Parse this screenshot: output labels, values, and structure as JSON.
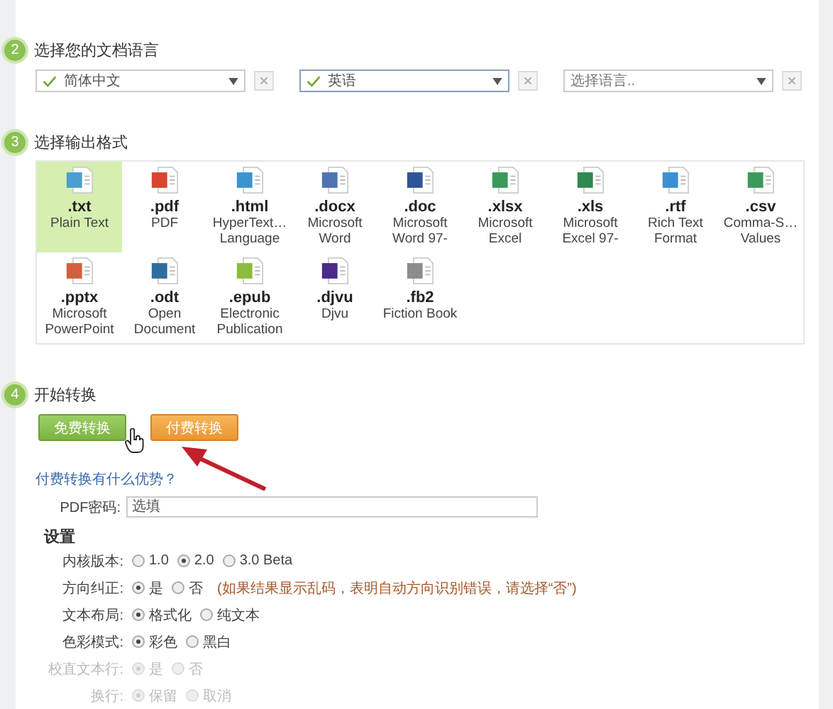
{
  "steps": [
    {
      "number": "2",
      "title": "选择您的文档语言"
    },
    {
      "number": "3",
      "title": "选择输出格式"
    },
    {
      "number": "4",
      "title": "开始转换"
    }
  ],
  "languages": [
    {
      "value": "简体中文",
      "checked": true,
      "focused": false
    },
    {
      "value": "英语",
      "checked": true,
      "focused": true
    },
    {
      "placeholder": "选择语言..",
      "checked": false,
      "focused": false
    }
  ],
  "formats": [
    {
      "ext": ".txt",
      "desc": [
        "Plain Text"
      ],
      "color": "#4a9fd0",
      "selected": true
    },
    {
      "ext": ".pdf",
      "desc": [
        "PDF"
      ],
      "color": "#d9442f",
      "selected": false
    },
    {
      "ext": ".html",
      "desc": [
        "HyperText…",
        "Language"
      ],
      "color": "#3b94d0",
      "selected": false
    },
    {
      "ext": ".docx",
      "desc": [
        "Microsoft",
        "Word"
      ],
      "color": "#4f73b0",
      "selected": false
    },
    {
      "ext": ".doc",
      "desc": [
        "Microsoft",
        "Word 97-"
      ],
      "color": "#2f5596",
      "selected": false
    },
    {
      "ext": ".xlsx",
      "desc": [
        "Microsoft",
        "Excel"
      ],
      "color": "#3a9a5a",
      "selected": false
    },
    {
      "ext": ".xls",
      "desc": [
        "Microsoft",
        "Excel 97-"
      ],
      "color": "#2e8a4e",
      "selected": false
    },
    {
      "ext": ".rtf",
      "desc": [
        "Rich Text",
        "Format"
      ],
      "color": "#3d8fd4",
      "selected": false
    },
    {
      "ext": ".csv",
      "desc": [
        "Comma-S…",
        "Values"
      ],
      "color": "#3a9a5a",
      "selected": false
    },
    {
      "ext": ".pptx",
      "desc": [
        "Microsoft",
        "PowerPoint"
      ],
      "color": "#d2603e",
      "selected": false
    },
    {
      "ext": ".odt",
      "desc": [
        "Open",
        "Document"
      ],
      "color": "#2f6e9a",
      "selected": false
    },
    {
      "ext": ".epub",
      "desc": [
        "Electronic",
        "Publication"
      ],
      "color": "#8dbb3a",
      "selected": false
    },
    {
      "ext": ".djvu",
      "desc": [
        "Djvu"
      ],
      "color": "#4b2a8a",
      "selected": false
    },
    {
      "ext": ".fb2",
      "desc": [
        "Fiction Book"
      ],
      "color": "#8c8c8c",
      "selected": false
    }
  ],
  "buttons": [
    {
      "label": "免费转换",
      "kind": "free"
    },
    {
      "label": "付费转换",
      "kind": "paid"
    }
  ],
  "link": "付费转换有什么优势？",
  "password": {
    "label": "PDF密码:",
    "placeholder": "选填"
  },
  "settings": {
    "title": "设置",
    "rows": [
      {
        "label": "内核版本:",
        "disabled": false,
        "options": [
          {
            "label": "1.0",
            "selected": false
          },
          {
            "label": "2.0",
            "selected": true
          },
          {
            "label": "3.0 Beta",
            "selected": false
          }
        ]
      },
      {
        "label": "方向纠正:",
        "disabled": false,
        "options": [
          {
            "label": "是",
            "selected": true
          },
          {
            "label": "否",
            "selected": false
          }
        ],
        "note": "(如果结果显示乱码，表明自动方向识别错误，请选择“否”)"
      },
      {
        "label": "文本布局:",
        "disabled": false,
        "options": [
          {
            "label": "格式化",
            "selected": true
          },
          {
            "label": "纯文本",
            "selected": false
          }
        ]
      },
      {
        "label": "色彩模式:",
        "disabled": false,
        "options": [
          {
            "label": "彩色",
            "selected": true
          },
          {
            "label": "黑白",
            "selected": false
          }
        ]
      },
      {
        "label": "校直文本行:",
        "disabled": true,
        "options": [
          {
            "label": "是",
            "selected": true
          },
          {
            "label": "否",
            "selected": false
          }
        ]
      },
      {
        "label": "换行:",
        "disabled": true,
        "options": [
          {
            "label": "保留",
            "selected": true
          },
          {
            "label": "取消",
            "selected": false
          }
        ]
      }
    ]
  }
}
